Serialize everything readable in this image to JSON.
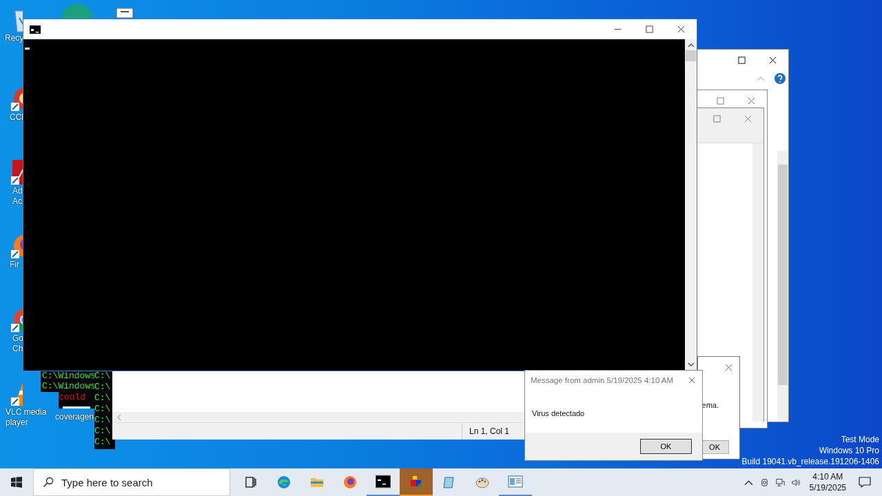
{
  "desktop_icons": [
    {
      "kind": "recycle-bin",
      "lines": [
        "Recy"
      ]
    },
    {
      "kind": "ccleaner",
      "lines": [
        "CCl"
      ]
    },
    {
      "kind": "acrobat",
      "lines": [
        "Ad",
        "Ac"
      ]
    },
    {
      "kind": "firefox",
      "lines": [
        "Fir"
      ]
    },
    {
      "kind": "chrome",
      "lines": [
        "Go",
        "Ch"
      ]
    },
    {
      "kind": "vlc",
      "lines": [
        "VLC media",
        "player"
      ]
    }
  ],
  "desktop_icon_2": {
    "label": "coveragen"
  },
  "consoles": [
    {
      "lines": [
        {
          "kind": "path",
          "text": "C:\\Windows"
        },
        {
          "kind": "path",
          "text": "C:\\Windows"
        }
      ]
    },
    {
      "lines": [
        {
          "kind": "error",
          "text": "could"
        }
      ]
    },
    {
      "lines": [
        {
          "kind": "path",
          "text": "C:\\"
        },
        {
          "kind": "path",
          "text": "C:\\"
        },
        {
          "kind": "path",
          "text": "C:\\"
        },
        {
          "kind": "path",
          "text": "C:\\"
        },
        {
          "kind": "path",
          "text": "C:\\"
        },
        {
          "kind": "path",
          "text": "C:\\"
        },
        {
          "kind": "path",
          "text": "C:\\"
        }
      ]
    }
  ],
  "editor": {
    "status": "Ln 1, Col 1"
  },
  "back_dialog": {
    "text": "ema.",
    "button": "OK"
  },
  "message_dialog": {
    "title": "Message from admin 5/19/2025 4:10 AM",
    "message": "Virus detectado",
    "button": "OK"
  },
  "system_info": [
    "Test Mode",
    "Windows 10 Pro",
    "Build 19041.vb_release.191206-1406"
  ],
  "taskbar": {
    "search_placeholder": "Type here to search",
    "apps": [
      {
        "kind": "task-view",
        "running": false,
        "selected": false
      },
      {
        "kind": "edge",
        "running": false,
        "selected": false
      },
      {
        "kind": "explorer",
        "running": false,
        "selected": false
      },
      {
        "kind": "firefox",
        "running": false,
        "selected": false
      },
      {
        "kind": "terminal",
        "running": true,
        "selected": false
      },
      {
        "kind": "shapes",
        "running": true,
        "selected": true
      },
      {
        "kind": "notebook",
        "running": false,
        "selected": false
      },
      {
        "kind": "paint",
        "running": false,
        "selected": false
      },
      {
        "kind": "window",
        "running": true,
        "selected": false
      }
    ],
    "time": "4:10 AM",
    "date": "5/19/2025"
  }
}
